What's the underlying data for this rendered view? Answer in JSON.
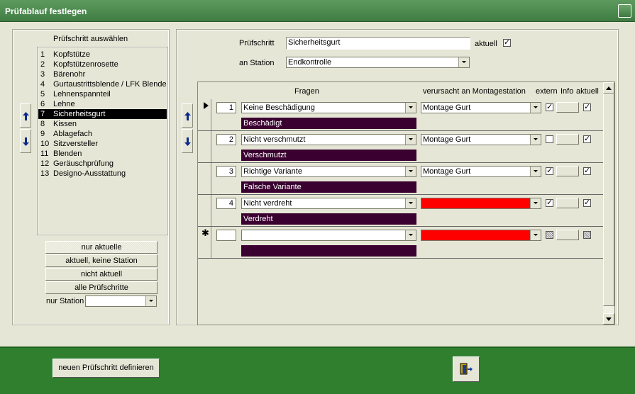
{
  "window": {
    "title": "Prüfablauf festlegen"
  },
  "left": {
    "header": "Prüfschritt auswählen",
    "items": [
      {
        "num": "1",
        "label": "Kopfstütze"
      },
      {
        "num": "2",
        "label": "Kopfstützenrosette"
      },
      {
        "num": "3",
        "label": "Bärenohr"
      },
      {
        "num": "4",
        "label": "Gurtaustrittsblende / LFK Blende"
      },
      {
        "num": "5",
        "label": "Lehnenspannteil"
      },
      {
        "num": "6",
        "label": "Lehne"
      },
      {
        "num": "7",
        "label": "Sicherheitsgurt"
      },
      {
        "num": "8",
        "label": "Kissen"
      },
      {
        "num": "9",
        "label": "Ablagefach"
      },
      {
        "num": "10",
        "label": "Sitzversteller"
      },
      {
        "num": "11",
        "label": "Blenden"
      },
      {
        "num": "12",
        "label": "Geräuschprüfung"
      },
      {
        "num": "13",
        "label": "Designo-Ausstattung"
      }
    ],
    "selected_index": 6,
    "filters": {
      "btn1": "nur aktuelle",
      "btn2": "aktuell, keine Station",
      "btn3": "nicht aktuell",
      "btn4": "alle Prüfschritte",
      "station_label": "nur Station",
      "station_value": ""
    }
  },
  "right": {
    "pruefschritt_label": "Prüfschritt",
    "pruefschritt_value": "Sicherheitsgurt",
    "aktuell_label": "aktuell",
    "aktuell_checked": true,
    "station_label": "an Station",
    "station_value": "Endkontrolle",
    "columns": {
      "fragen": "Fragen",
      "verursacht": "verursacht an Montagestation",
      "extern": "extern",
      "info": "Info",
      "aktuell": "aktuell"
    },
    "rows": [
      {
        "num": "1",
        "frage": "Keine Beschädigung",
        "fehler": "Beschädigt",
        "station": "Montage Gurt",
        "extern": true,
        "aktuell": true
      },
      {
        "num": "2",
        "frage": "Nicht verschmutzt",
        "fehler": "Verschmutzt",
        "station": "Montage Gurt",
        "extern": false,
        "aktuell": true
      },
      {
        "num": "3",
        "frage": "Richtige Variante",
        "fehler": "Falsche Variante",
        "station": "Montage Gurt",
        "extern": true,
        "aktuell": true
      },
      {
        "num": "4",
        "frage": "Nicht verdreht",
        "fehler": "Verdreht",
        "station": "",
        "extern": true,
        "aktuell": true
      },
      {
        "num": "",
        "frage": "",
        "fehler": "",
        "station": "",
        "extern": null,
        "aktuell": null
      }
    ]
  },
  "footer": {
    "new_button": "neuen Prüfschritt definieren"
  },
  "colors": {
    "footer": "#2f7f2f",
    "title": "#4a884c",
    "bar": "#3a0030",
    "red": "#ff0000"
  },
  "icons": [
    "arrow-up-icon",
    "arrow-down-icon",
    "exit-door-icon",
    "record-pointer-icon",
    "new-record-icon"
  ]
}
